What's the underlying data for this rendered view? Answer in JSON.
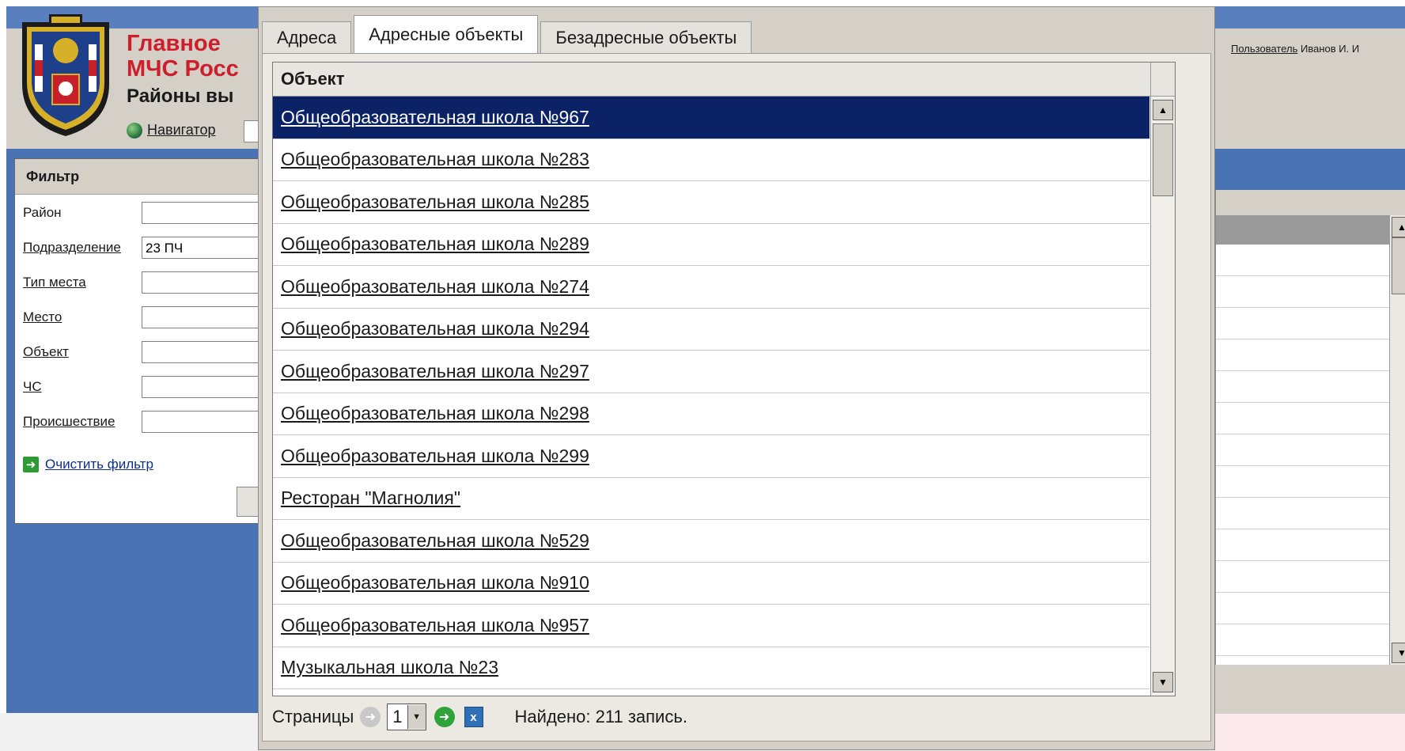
{
  "app": {
    "brand_title": "Главное",
    "brand_subtitle": "МЧС Росс",
    "page_title": "Районы вы",
    "nav_link": "Навигатор",
    "user_link": "Пользователь",
    "user_name": "Иванов И. И"
  },
  "filter": {
    "title": "Фильтр",
    "fields": [
      {
        "label": "Район",
        "value": ""
      },
      {
        "label": "Подразделение",
        "value": "23 ПЧ"
      },
      {
        "label": "Тип места",
        "value": ""
      },
      {
        "label": "Место",
        "value": ""
      },
      {
        "label": "Объект",
        "value": ""
      },
      {
        "label": "ЧС",
        "value": ""
      },
      {
        "label": "Происшествие",
        "value": ""
      }
    ],
    "clear_label": "Очистить фильтр"
  },
  "modal": {
    "tabs": [
      {
        "label": "Адреса",
        "active": false
      },
      {
        "label": "Адресные объекты",
        "active": true
      },
      {
        "label": "Безадресные объекты",
        "active": false
      }
    ],
    "column_header": "Объект",
    "rows": [
      "Общеобразовательная школа №967",
      "Общеобразовательная школа №283",
      "Общеобразовательная школа №285",
      "Общеобразовательная школа №289",
      "Общеобразовательная школа №274",
      "Общеобразовательная школа №294",
      "Общеобразовательная школа №297",
      "Общеобразовательная школа №298",
      "Общеобразовательная школа №299",
      "Ресторан \"Магнолия\"",
      "Общеобразовательная школа №529",
      "Общеобразовательная школа №910",
      "Общеобразовательная школа №957",
      "Музыкальная школа №23"
    ],
    "selected_row": 0,
    "pager": {
      "label": "Страницы",
      "current_page": "1",
      "found_text": "Найдено: 211 запись."
    }
  },
  "colors": {
    "selection": "#0b2266",
    "brand_red": "#cc1f2b",
    "frame_blue": "#4a73b4",
    "chrome_gray": "#d4d0c8"
  },
  "icons": {
    "nav": "globe-icon",
    "clear": "green-arrow-icon",
    "pager_prev": "prev-arrow-icon",
    "pager_next": "next-arrow-icon",
    "excel": "excel-icon"
  }
}
